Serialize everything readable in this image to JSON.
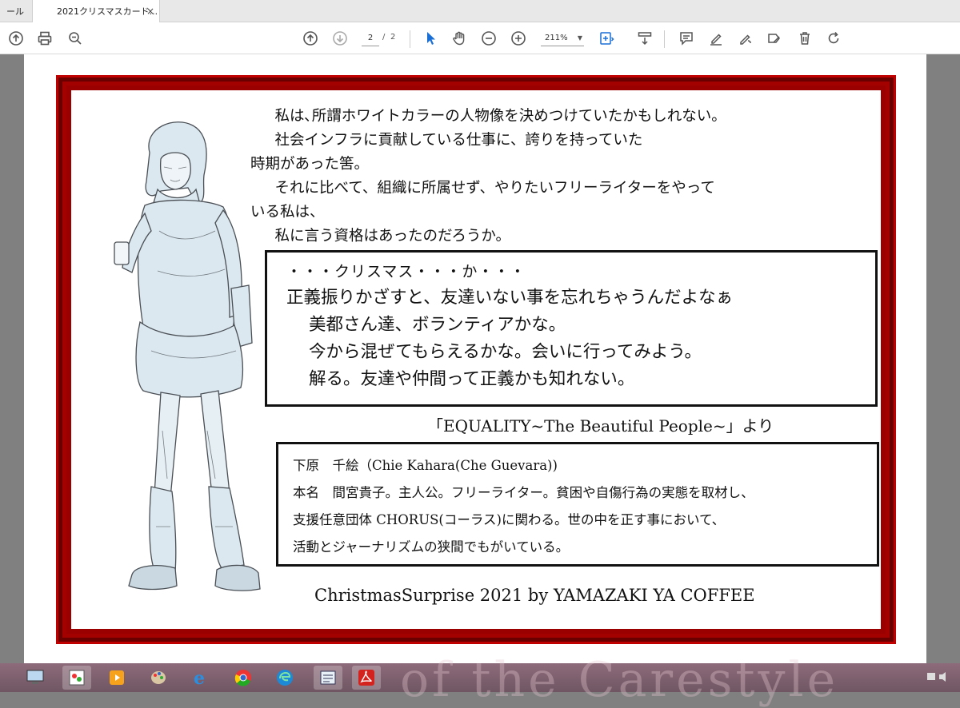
{
  "tabs": {
    "inactive_label": "ール",
    "active_label": "2021クリスマスカード...",
    "close_glyph": "×"
  },
  "toolbar": {
    "page_current": "2",
    "page_separator": "/",
    "page_total": "2",
    "zoom": "211%",
    "icons": [
      "upload-icon",
      "print-icon",
      "zoom-search-icon",
      "prev-page-icon",
      "next-page-icon",
      "select-cursor-icon",
      "hand-icon",
      "zoom-out-icon",
      "zoom-in-icon",
      "fit-page-icon",
      "scroll-mode-icon",
      "comment-icon",
      "highlight-icon",
      "draw-icon",
      "fill-sign-icon",
      "delete-icon",
      "rotate-icon"
    ]
  },
  "document": {
    "narrative": [
      "　私は､所謂ホワイトカラーの人物像を決めつけていたかもしれない。",
      "　社会インフラに貢献している仕事に、誇りを持っていた",
      "時期があった筈。",
      "　それに比べて、組織に所属せず、やりたいフリーライターをやって",
      "いる私は、",
      "　私に言う資格はあったのだろうか。"
    ],
    "quote_box": {
      "line1": "・・・クリスマス・・・か・・・",
      "line2": "正義振りかざすと、友達いない事を忘れちゃうんだよなぁ",
      "line3": "美都さん達、ボランティアかな。",
      "line4": "今から混ぜてもらえるかな。会いに行ってみよう。",
      "line5": "解る。友達や仲間って正義かも知れない。"
    },
    "source": "「EQUALITY~The Beautiful People~」より",
    "profile_box": {
      "line1": "下原　千絵（Chie Kahara(Che Guevara))",
      "line2": "本名　間宮貴子。主人公。フリーライター。貧困や自傷行為の実態を取材し、",
      "line3": "支援任意団体 CHORUS(コーラス)に関わる。世の中を正す事において、",
      "line4": "活動とジャーナリズムの狭間でもがいている。"
    },
    "footer": "ChristmasSurprise 2021 by YAMAZAKI YA COFFEE"
  },
  "taskbar": {
    "background_text": "of the Carestyle",
    "apps": [
      "computer-icon",
      "paint-app-icon",
      "media-player-icon",
      "paint-palette-icon",
      "internet-explorer-icon",
      "chrome-icon",
      "edge-icon",
      "notepad-icon",
      "acrobat-icon"
    ]
  },
  "colors": {
    "frame_red": "#9a0000",
    "frame_bright": "#c00000",
    "accent_blue": "#1a6fd6",
    "acrobat_red": "#d4231f"
  }
}
